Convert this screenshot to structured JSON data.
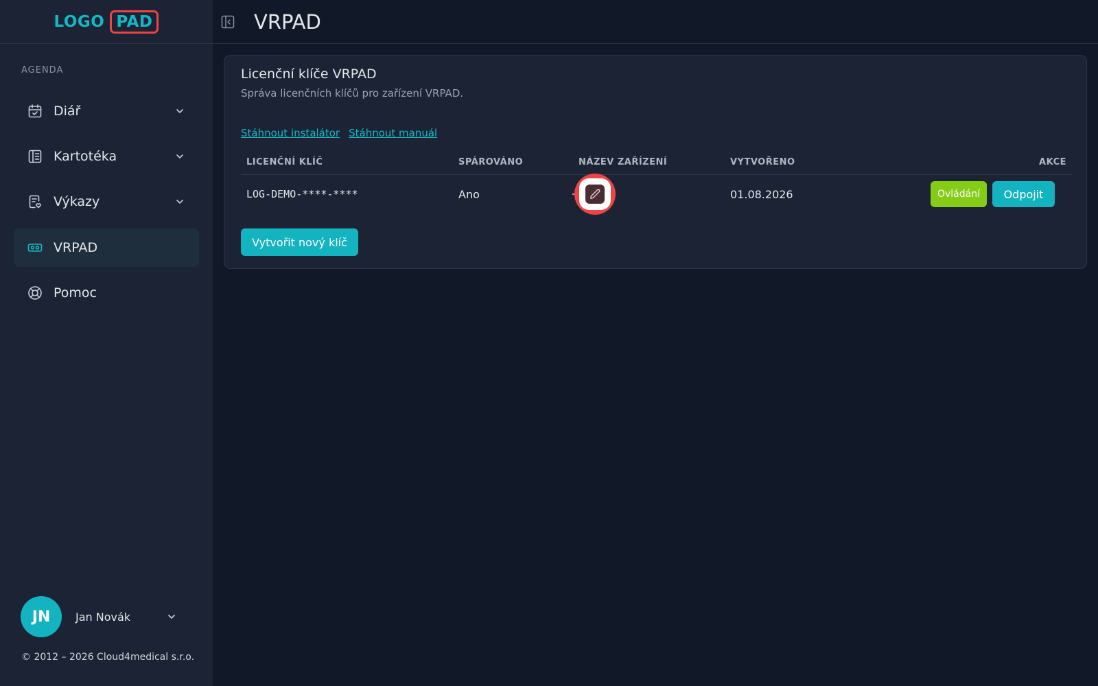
{
  "logo": {
    "part1": "LOGO",
    "part2": "PAD"
  },
  "sidebar": {
    "section_label": "AGENDA",
    "items": [
      {
        "label": "Diář",
        "icon": "calendar-check-icon"
      },
      {
        "label": "Kartotéka",
        "icon": "notebook-icon"
      },
      {
        "label": "Výkazy",
        "icon": "report-icon"
      },
      {
        "label": "VRPAD",
        "icon": "vr-headset-icon"
      },
      {
        "label": "Pomoc",
        "icon": "lifebuoy-icon"
      }
    ],
    "active_item": "VRPAD"
  },
  "user": {
    "initials": "JN",
    "name": "Jan Novák"
  },
  "footer": {
    "copyright": "© 2012 – 2026 Cloud4medical s.r.o."
  },
  "header": {
    "title": "VRPAD"
  },
  "card": {
    "title": "Licenční klíče VRPAD",
    "subtitle": "Správa licenčních klíčů pro zařízení VRPAD.",
    "links": {
      "installer": "Stáhnout instalátor",
      "manual": "Stáhnout manuál"
    },
    "table": {
      "columns": [
        "LICENČNÍ KLÍČ",
        "SPÁROVÁNO",
        "NÁZEV ZAŘÍZENÍ",
        "VYTVOŘENO",
        "AKCE"
      ],
      "rows": [
        {
          "key": "LOG-DEMO-****-****",
          "paired": "Ano",
          "device_name": "",
          "created": "01.08.2026"
        }
      ],
      "actions": {
        "control": "Ovládání",
        "disconnect": "Odpojit"
      }
    },
    "new_key_button": "Vytvořit nový klíč"
  },
  "colors": {
    "accent": "#13b3bf",
    "control_button": "#84cc16",
    "highlight": "#ef4444",
    "background": "#111827",
    "panel": "#1b2335"
  }
}
